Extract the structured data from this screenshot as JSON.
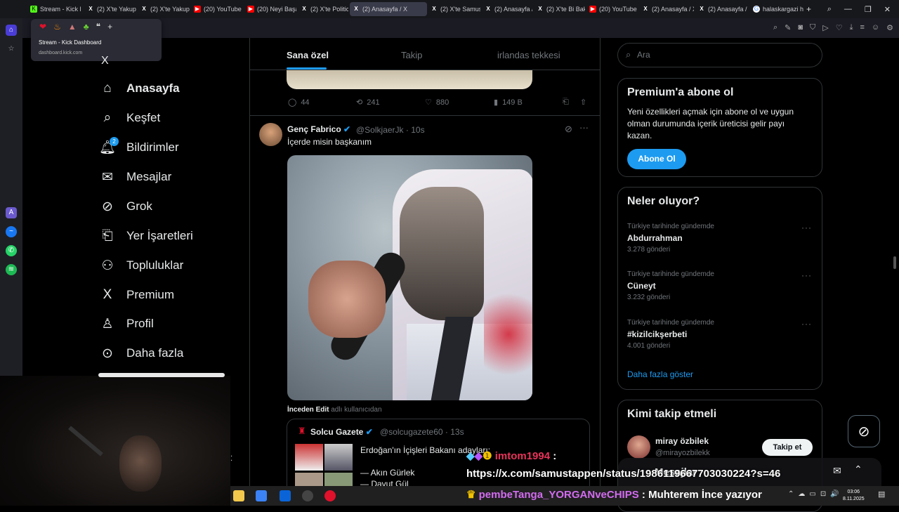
{
  "browser": {
    "tabs": [
      {
        "label": "Stream - Kick D",
        "icon": "kick",
        "active": false
      },
      {
        "label": "(2) X'te Yakup T",
        "icon": "x",
        "active": false
      },
      {
        "label": "(2) X'te Yakup T",
        "icon": "x",
        "active": false
      },
      {
        "label": "(20) YouTube",
        "icon": "youtube",
        "active": false
      },
      {
        "label": "(20) Neyi Başar",
        "icon": "youtube",
        "active": false
      },
      {
        "label": "(2) X'te Politic T",
        "icon": "x",
        "active": false
      },
      {
        "label": "(2) Anasayfa / X",
        "icon": "x",
        "active": true
      },
      {
        "label": "(2) X'te Samust",
        "icon": "x",
        "active": false
      },
      {
        "label": "(2) Anasayfa / X",
        "icon": "x",
        "active": false
      },
      {
        "label": "(2) X'te Bi Bakt",
        "icon": "x",
        "active": false
      },
      {
        "label": "(20) YouTube",
        "icon": "youtube",
        "active": false
      },
      {
        "label": "(2) Anasayfa / X",
        "icon": "x",
        "active": false
      },
      {
        "label": "(2) Anasayfa / X",
        "icon": "x",
        "active": false
      },
      {
        "label": "halaskargazi ha",
        "icon": "google",
        "active": false
      }
    ],
    "popup": {
      "title": "Stream - Kick Dashboard",
      "url": "dashboard.kick.com"
    }
  },
  "nav": {
    "items": [
      {
        "label": "Anasayfa",
        "icon": "home-icon"
      },
      {
        "label": "Keşfet",
        "icon": "search-icon"
      },
      {
        "label": "Bildirimler",
        "icon": "bell-icon",
        "badge": "2"
      },
      {
        "label": "Mesajlar",
        "icon": "mail-icon"
      },
      {
        "label": "Grok",
        "icon": "grok-icon"
      },
      {
        "label": "Yer İşaretleri",
        "icon": "bookmark-icon"
      },
      {
        "label": "Topluluklar",
        "icon": "communities-icon"
      },
      {
        "label": "Premium",
        "icon": "x-logo-icon"
      },
      {
        "label": "Profil",
        "icon": "person-icon"
      },
      {
        "label": "Daha fazla",
        "icon": "more-icon"
      }
    ]
  },
  "feed": {
    "tabs": [
      "Sana özel",
      "Takip",
      "irlandas tekkesi"
    ],
    "prev_actions": {
      "replies": "44",
      "reposts": "241",
      "likes": "880",
      "views": "149 B"
    },
    "tweet": {
      "name": "Genç Fabrico",
      "handle": "@SolkjaerJk",
      "time": "· 10s",
      "text": "İçerde misin başkanım",
      "edit_by": "İnceden Edit",
      "edit_suffix": "adlı kullanıcıdan"
    },
    "quote": {
      "name": "Solcu Gazete",
      "handle": "@solcugazete60 · 13s",
      "headline": "Erdoğan'ın İçişleri Bakanı adayları:",
      "line1": "— Akın Gürlek",
      "line2": "— Davut Gül"
    }
  },
  "right": {
    "search_placeholder": "Ara",
    "premium": {
      "title": "Premium'a abone ol",
      "desc": "Yeni özellikleri açmak için abone ol ve uygun olman durumunda içerik üreticisi gelir payı kazan.",
      "button": "Abone Ol"
    },
    "trends": {
      "title": "Neler oluyor?",
      "items": [
        {
          "context": "Türkiye tarihinde gündemde",
          "title": "Abdurrahman",
          "count": "3.278 gönderi"
        },
        {
          "context": "Türkiye tarihinde gündemde",
          "title": "Cüneyt",
          "count": "3.232 gönderi"
        },
        {
          "context": "Türkiye tarihinde gündemde",
          "title": "#kizilcikşerbeti",
          "count": "4.001 gönderi"
        }
      ],
      "show_more": "Daha fazla göster"
    },
    "who_to_follow": {
      "title": "Kimi takip etmeli",
      "name": "miray özbilek",
      "handle": "@mirayozbilekk",
      "button": "Takip et"
    },
    "messages_label": "Mesajlar"
  },
  "chat": {
    "msg1_user": "imtom1994",
    "msg1_text": "https://x.com/samustappen/status/1986119667703030224?s=46",
    "msg2_user": "pembeTanga_YORGANveCHIPS",
    "msg2_text": "Muhterem İnce yazıyor"
  },
  "taskbar": {
    "time": "03:06",
    "date": "8.11.2025"
  }
}
